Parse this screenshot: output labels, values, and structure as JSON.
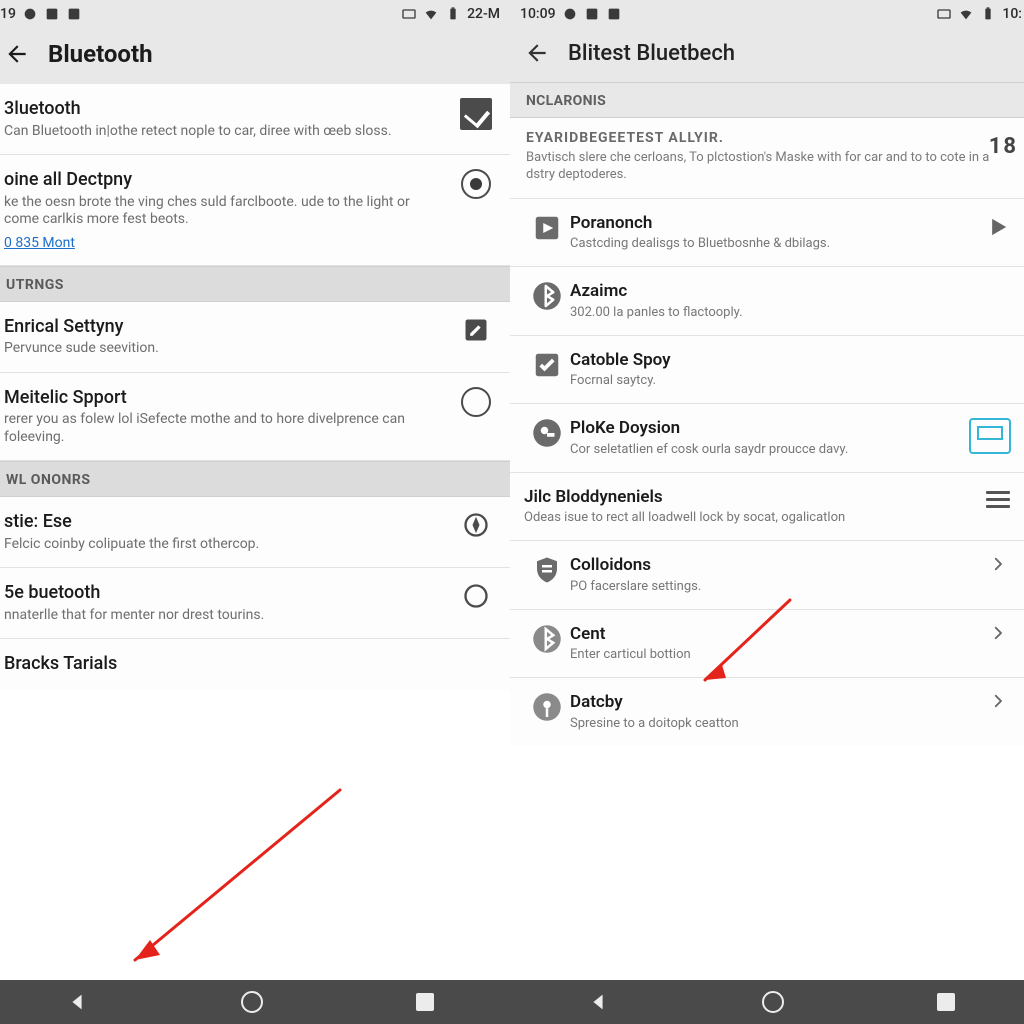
{
  "left": {
    "status": {
      "time": "19",
      "right_text": "22-M"
    },
    "toolbar": {
      "title": "Bluetooth"
    },
    "top_items": [
      {
        "type": "checkbox",
        "title": "3luetooth",
        "sub": "Can Bluetooth in|othe retect nople to car, diree with œeb sloss."
      },
      {
        "type": "radio_on",
        "title": "oine all Dectpny",
        "sub": "ke the oesn brote the ving ches suld farclboote. ude to the light or come carlkis more fest beots.",
        "link": "0 835 Mont"
      }
    ],
    "sections": [
      {
        "header": "UTRNGS",
        "items": [
          {
            "title": "Enrical Settyny",
            "sub": "Pervunce sude seevition.",
            "trail": "pencil-box"
          },
          {
            "title": "Meitelic Spport",
            "sub": "rerer you as folew lol iSefecte mothe and to hore divelprence can foleeving.",
            "trail": "radio-off"
          }
        ]
      },
      {
        "header": "WL ONONRS",
        "items": [
          {
            "title": "stie: Ese",
            "sub": "Felcic coinby colipuate the first othercop.",
            "trail": "compass"
          },
          {
            "title": "5e buetooth",
            "sub": "nnaterlle that for menter nor drest tourins.",
            "trail": "moon"
          },
          {
            "title": "Bracks Tarials",
            "sub": ""
          }
        ]
      }
    ]
  },
  "right": {
    "status": {
      "time": "10:09",
      "right_text": "10:"
    },
    "toolbar": {
      "title": "Blitest Bluetbech"
    },
    "header": "NCLARONIS",
    "info": {
      "title": "EYARIDBEGEETEST ALLYIR.",
      "sub": "Bavtisch slere che cerloans, To plctostion's Maske with for car and to to cote in a dstry deptoderes.",
      "trail": "18"
    },
    "items": [
      {
        "lead": "play-box",
        "title": "Poranonch",
        "sub": "Castcding dealisgs to Bluetbosnhe & dbilags.",
        "trail": "play"
      },
      {
        "lead": "bt",
        "title": "Azaimc",
        "sub": "302.00 la panles to flactooply."
      },
      {
        "lead": "check-box",
        "title": "Catoble Spoy",
        "sub": "Focrnal saytcy."
      },
      {
        "lead": "key",
        "title": "PloKe Doysion",
        "sub": "Cor seletatlien ef cosk ourla saydr proucce davy.",
        "trail": "cyan"
      },
      {
        "lead": "none",
        "title": "Jilc Bloddyneniels",
        "sub": "Odeas isue to rect all loadwell lock by socat, ogalicatlon",
        "trail": "hamb"
      },
      {
        "lead": "shield",
        "title": "Colloidons",
        "sub": "PO facerslare settings.",
        "trail": "chev"
      },
      {
        "lead": "bt2",
        "title": "Cent",
        "sub": "Enter carticul bottion",
        "trail": "chev"
      },
      {
        "lead": "pin",
        "title": "Datcby",
        "sub": "Spresine to a doitopk ceatton",
        "trail": "chev"
      }
    ]
  }
}
